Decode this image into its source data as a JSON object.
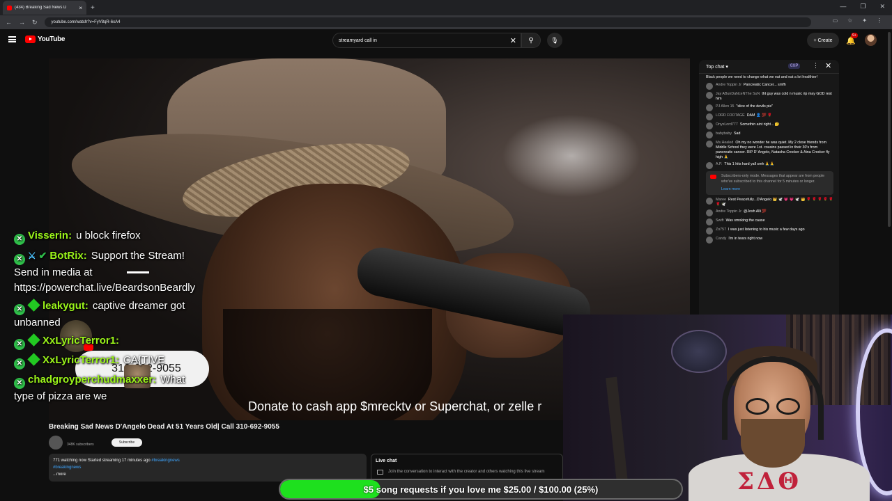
{
  "browser": {
    "tab_title": "(434) Breaking Sad News D",
    "url": "youtube.com/watch?v=FyV8qR-6xA4"
  },
  "youtube": {
    "logo_text": "YouTube",
    "search_value": "streamyard call in",
    "create_label": "Create",
    "notif_badge": "9+"
  },
  "video": {
    "ticker": "Donate to cash app $mrecktv or Superchat, or zelle r",
    "title": "Breaking Sad News D'Angelo Dead At 51 Years Old| Call 310-692-9055",
    "subscribe_label": "Subscribe",
    "subs": "348K subscribers",
    "desc_stats": "771 watching now  Started streaming 17 minutes ago",
    "desc_hashtag": "#breakingnews",
    "desc_hashtag2": "#breakingnews",
    "desc_more": "...more",
    "livechat_label": "Live chat",
    "livechat_text": "Join the conversation to interact with the creator and others watching this live stream"
  },
  "chat": {
    "header": "Top chat",
    "xp": "0XP",
    "first_text": "Black people we need to change what we eat and eat a lot healthier!",
    "messages": [
      {
        "name": "Andre Toppin Jr",
        "text": "Pancreatic Cancer... smfh"
      },
      {
        "name": "Jay ABunDaNceNThe SuN",
        "text": "tht guy was cold n music rip may GOD rest him"
      },
      {
        "name": "PJ Allen 15",
        "text": "\"slice of the devils pie\""
      },
      {
        "name": "LORD FOOTAGE",
        "text": "DAM 👤 💯 🌹"
      },
      {
        "name": "OnyxLord777",
        "text": "Somethin aint right... 🤔"
      },
      {
        "name": "babybaby",
        "text": "Sad"
      },
      {
        "name": "Ms.Healed",
        "text": "Oh my no wonder he was quiet. My 2 close friends from Middle School they were 1st. cousins passed in their 30's from pancreatic cancer. RIP D' Angelo, Natasha Crocker & Aina Crocker fly high 🙏"
      },
      {
        "name": "A.P.",
        "text": "This 1 hits hard yall smh 🙏🙏"
      }
    ],
    "notice": "Subscribers-only mode. Messages that appear are from people who've subscribed to this channel for 5 minutes or longer.",
    "notice_link": "Learn more",
    "messages2": [
      {
        "name": "Maree",
        "text": "Rest Peacefully...D'Angelo 👑 🕊️ 💗 💗 🕊️ 👑 🌹 🌹 🌹 🌹 🌹 🌹 🕊️"
      },
      {
        "name": "Andre Toppin Jr",
        "text": "@Josh Alli 💯"
      },
      {
        "name": "Swift",
        "text": "Was smoking the cause"
      },
      {
        "name": "Zo757",
        "text": "I was just listening to his music a few days ago"
      },
      {
        "name": "Candy",
        "text": "I'm in tears right now"
      }
    ]
  },
  "overlay_chat": [
    {
      "name": "Visserin:",
      "text": "u block firefox"
    },
    {
      "name": "BotRix:",
      "text": "Support the Stream! Send in media at https://powerchat.live/BeardsonBeardly"
    },
    {
      "name": "leakygut:",
      "text": "captive dreamer got unbanned"
    },
    {
      "name": "XxLyricTerror1:",
      "text": ""
    },
    {
      "name": "XxLyricTerror1:",
      "text": "CA{TIVE"
    },
    {
      "name": "chadgroyperchudmaxxer:",
      "text": "What type of pizza are we"
    }
  ],
  "phone_pill": "310-692-9055",
  "progress": {
    "label": "$5 song requests if you love me $25.00 / $100.00 (25%)",
    "fraction": 0.25
  }
}
